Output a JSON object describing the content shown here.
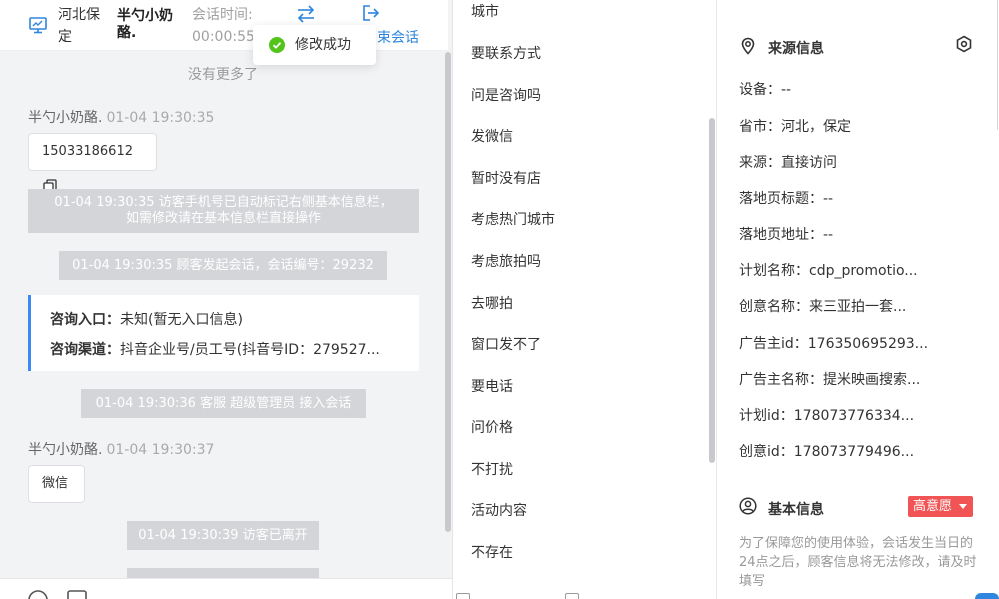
{
  "chat": {
    "header": {
      "location": "河北保定",
      "visitor_name": "半勺小奶酪.",
      "session_time_label": "会话时间:",
      "session_time_value": "00:00:55",
      "end_session_label": "束会话"
    },
    "toast": {
      "text": "修改成功"
    },
    "no_more": "没有更多了",
    "messages": [
      {
        "sender": "半勺小奶酪.",
        "time": "01-04 19:30:35",
        "content": "15033186612"
      },
      {
        "system_line1": "01-04 19:30:35 访客手机号已自动标记右侧基本信息栏，",
        "system_line2": "如需修改请在基本信息栏直接操作"
      },
      {
        "system": "01-04 19:30:35 顾客发起会话，会话编号：29232"
      },
      {
        "system": "01-04 19:30:36 客服 超级管理员 接入会话"
      },
      {
        "sender": "半勺小奶酪.",
        "time": "01-04 19:30:37",
        "content": "微信"
      },
      {
        "system": "01-04 19:30:39 访客已离开"
      }
    ],
    "entry_card": {
      "entry_label": "咨询入口：",
      "entry_value": "未知(暂无入口信息)",
      "channel_label": "咨询渠道：",
      "channel_value": "抖音企业号/员工号(抖音号ID：279527..."
    }
  },
  "tags": [
    "城市",
    "要联系方式",
    "问是咨询吗",
    "发微信",
    "暂时没有店",
    "考虑热门城市",
    "考虑旅拍吗",
    "去哪拍",
    "窗口发不了",
    "要电话",
    "问价格",
    "不打扰",
    "活动内容",
    "不存在"
  ],
  "info": {
    "source_title": "来源信息",
    "source_rows": [
      "设备：--",
      "省市：河北，保定",
      "来源：直接访问",
      "落地页标题：--",
      "落地页地址：--",
      "计划名称：cdp_promotio...",
      "创意名称：来三亚拍一套...",
      "广告主id：176350695293...",
      "广告主名称：提米映画搜索...",
      "计划id：178073776334...",
      "创意id：178073779496..."
    ],
    "basic_title": "基本信息",
    "intent_badge": "高意愿",
    "notice": "为了保障您的使用体验，会话发生当日的24点之后，顾客信息将无法修改，请及时填写"
  },
  "colors": {
    "accent": "#2e86de",
    "success": "#52c41a",
    "intent": "#f05454",
    "card_border": "#3d8af7"
  }
}
